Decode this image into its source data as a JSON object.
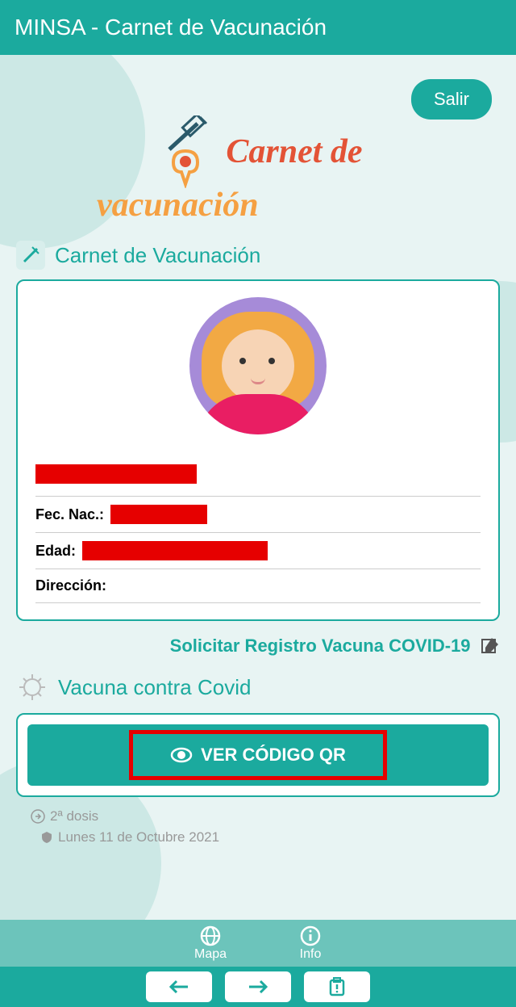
{
  "header": {
    "title": "MINSA - Carnet de Vacunación"
  },
  "exit": "Salir",
  "logo": {
    "line1": "Carnet de",
    "line2": "vacunación"
  },
  "section": {
    "title": "Carnet de Vacunación"
  },
  "profile": {
    "fec_label": "Fec. Nac.:",
    "edad_label": "Edad:",
    "direccion_label": "Dirección:"
  },
  "request": "Solicitar Registro Vacuna COVID-19",
  "covid": {
    "title": "Vacuna contra Covid",
    "qr_button": "VER CÓDIGO QR",
    "dose": "2ª dosis",
    "date": "Lunes 11 de Octubre 2021"
  },
  "tabs": {
    "mapa": "Mapa",
    "info": "Info"
  }
}
